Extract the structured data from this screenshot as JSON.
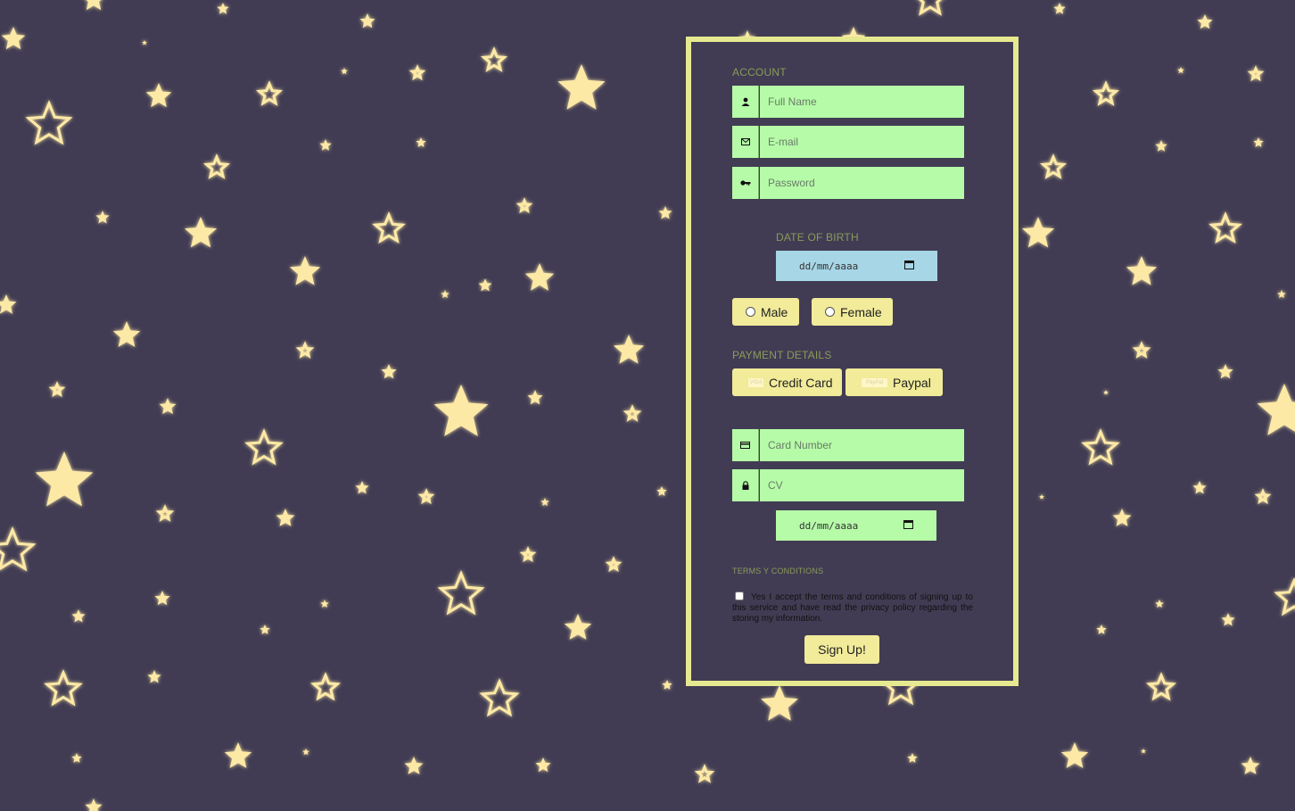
{
  "colors": {
    "background": "#413c53",
    "frame": "#e6e98f",
    "input_green": "#b6fca8",
    "date_blue": "#a7d6e6",
    "button_yellow": "#f1eb9a",
    "heading": "#8a9b5a",
    "star": "#fde9a6"
  },
  "account": {
    "title": "ACCOUNT",
    "full_name": {
      "placeholder": "Full Name",
      "icon": "user-icon"
    },
    "email": {
      "placeholder": "E-mail",
      "icon": "envelope-icon"
    },
    "password": {
      "placeholder": "Password",
      "icon": "key-icon"
    }
  },
  "dob": {
    "title": "DATE OF BIRTH",
    "placeholder": "dd/mm/aaaa",
    "icon": "calendar-icon"
  },
  "gender": {
    "male": "Male",
    "female": "Female"
  },
  "payment": {
    "title": "PAYMENT DETAILS",
    "credit_card": "Credit Card",
    "credit_logo": "VISA",
    "paypal": "Paypal",
    "paypal_logo": "PayPal",
    "card_number": {
      "placeholder": "Card Number",
      "icon": "credit-card-icon"
    },
    "cv": {
      "placeholder": "CV",
      "icon": "lock-icon"
    },
    "expiry_placeholder": "dd/mm/aaaa"
  },
  "terms": {
    "title": "TERMS Y CONDITIONS",
    "text": "Yes I accept the terms and conditions of signing up to this service and have read the privacy policy regarding the storing my information."
  },
  "submit": {
    "label": "Sign Up!"
  }
}
